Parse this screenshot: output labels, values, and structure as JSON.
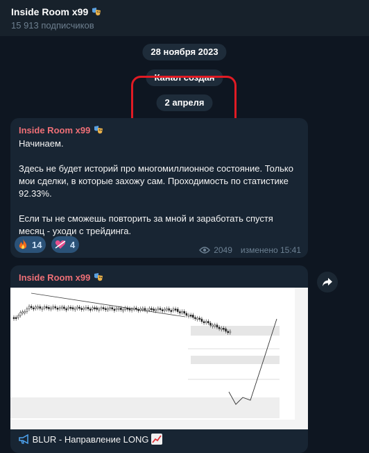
{
  "channel": {
    "title": "Inside Room x99",
    "subscribers": "15 913 подписчиков"
  },
  "service": {
    "date_pill": "28 ноября 2023",
    "created_pill": "Канал создан",
    "date_pill_2": "2 апреля"
  },
  "message1": {
    "sender": "Inside Room x99",
    "paragraphs": [
      "Начинаем.",
      "Здесь не будет историй про многомиллионное состояние. Только мои сделки, в которые захожу сам. Проходимость по статистике 92.33%.",
      "Если ты не сможешь повторить за мной и заработать спустя месяц - уходи с трейдинга."
    ],
    "reactions": [
      {
        "icon": "fire-icon",
        "count": "14"
      },
      {
        "icon": "heart-arrow-icon",
        "count": "4"
      }
    ],
    "views": "2049",
    "edited": "изменено 15:41"
  },
  "message2": {
    "sender": "Inside Room x99",
    "caption": "BLUR - Направление LONG"
  },
  "colors": {
    "background": "#0e1621",
    "header": "#17212b",
    "bubble": "#182533",
    "sender": "#ee6f76",
    "reaction": "#2b5278",
    "highlight_box": "#e01b24"
  }
}
